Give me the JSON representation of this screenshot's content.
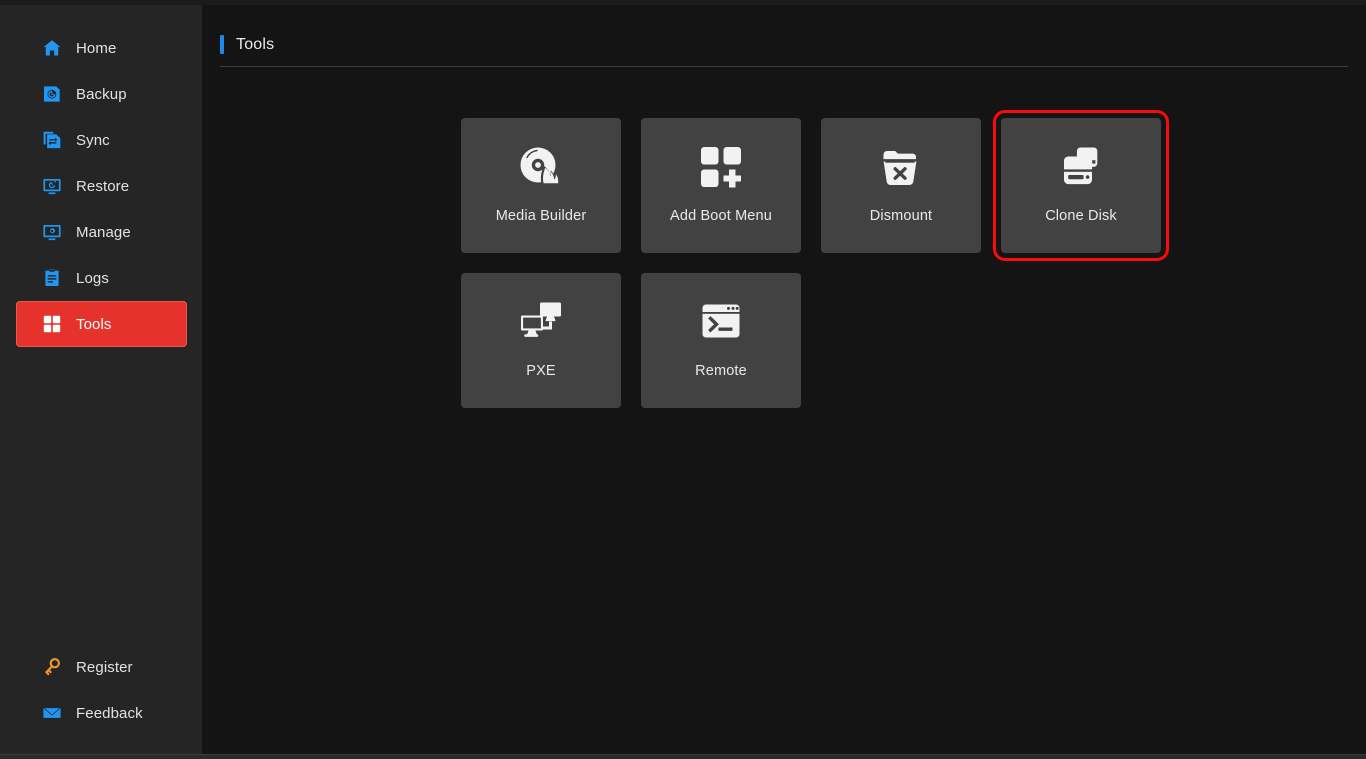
{
  "app": {
    "page_title": "Tools",
    "accent_color": "#1e88e5",
    "selected_nav_color": "#e5332c",
    "highlight_border_color": "#fb0a0a",
    "card_background": "#424242",
    "sidebar_background": "#252525",
    "content_background": "#141414"
  },
  "sidebar": {
    "items": [
      {
        "label": "Home",
        "icon": "home-icon",
        "active": false
      },
      {
        "label": "Backup",
        "icon": "backup-icon",
        "active": false
      },
      {
        "label": "Sync",
        "icon": "sync-icon",
        "active": false
      },
      {
        "label": "Restore",
        "icon": "restore-icon",
        "active": false
      },
      {
        "label": "Manage",
        "icon": "manage-icon",
        "active": false
      },
      {
        "label": "Logs",
        "icon": "logs-icon",
        "active": false
      },
      {
        "label": "Tools",
        "icon": "tools-grid-icon",
        "active": true
      }
    ],
    "bottom_items": [
      {
        "label": "Register",
        "icon": "key-icon"
      },
      {
        "label": "Feedback",
        "icon": "envelope-icon"
      }
    ]
  },
  "main": {
    "tools": [
      {
        "label": "Media Builder",
        "icon": "disc-flame-icon",
        "selected": false
      },
      {
        "label": "Add Boot Menu",
        "icon": "squares-plus-icon",
        "selected": false
      },
      {
        "label": "Dismount",
        "icon": "bin-x-icon",
        "selected": false
      },
      {
        "label": "Clone Disk",
        "icon": "stacked-disks-icon",
        "selected": true
      },
      {
        "label": "PXE",
        "icon": "two-monitors-icon",
        "selected": false
      },
      {
        "label": "Remote",
        "icon": "terminal-window-icon",
        "selected": false
      }
    ]
  }
}
